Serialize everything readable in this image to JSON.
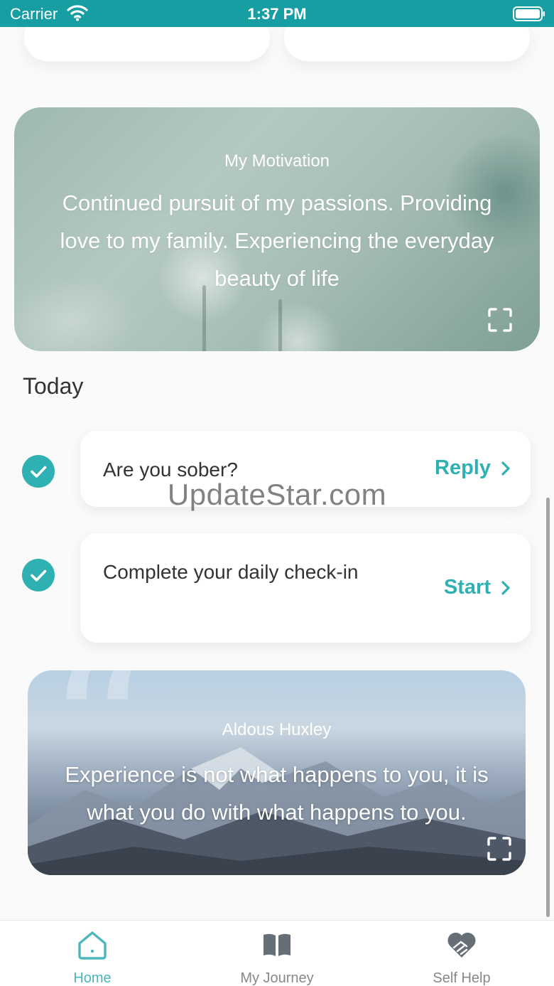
{
  "status_bar": {
    "carrier": "Carrier",
    "time": "1:37 PM"
  },
  "motivation": {
    "title": "My Motivation",
    "text": "Continued pursuit of my passions. Providing love to my family. Experiencing the everyday beauty of life"
  },
  "today": {
    "heading": "Today",
    "tasks": [
      {
        "label": "Are you sober?",
        "action": "Reply",
        "completed": true
      },
      {
        "label": "Complete your daily check-in",
        "action": "Start",
        "completed": true
      }
    ]
  },
  "quote": {
    "author": "Aldous Huxley",
    "text": "Experience is not what happens to you, it is what you do with what happens to you."
  },
  "watermark": "UpdateStar.com",
  "tabs": [
    {
      "label": "Home",
      "icon": "home-icon",
      "active": true
    },
    {
      "label": "My Journey",
      "icon": "book-icon",
      "active": false
    },
    {
      "label": "Self Help",
      "icon": "heart-hands-icon",
      "active": false
    }
  ],
  "colors": {
    "status_bar": "#169ea3",
    "accent": "#2fb0b3",
    "tab_active": "#4bb6bb",
    "tab_inactive": "#888888"
  }
}
